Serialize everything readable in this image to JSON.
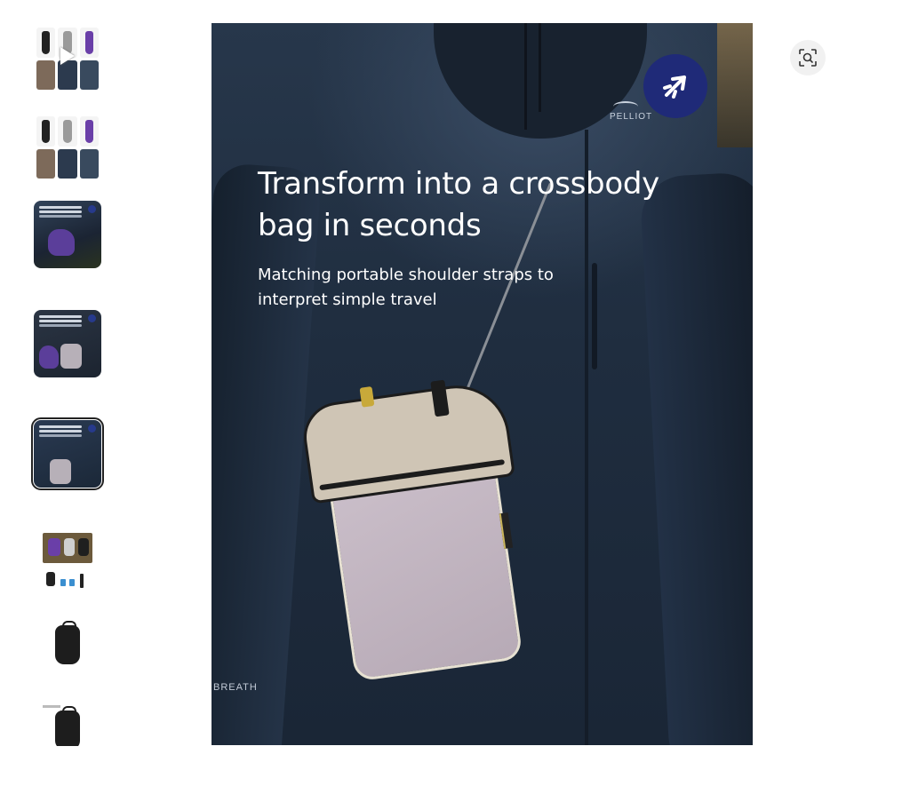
{
  "thumbnails": [
    {
      "label": "Video preview",
      "kind": "grid-video"
    },
    {
      "label": "Product variants",
      "kind": "grid"
    },
    {
      "label": "Purple bag photo",
      "kind": "photo-purple"
    },
    {
      "label": "Backpack photo",
      "kind": "photo-backpack"
    },
    {
      "label": "Crossbody photo",
      "kind": "photo-crossbody",
      "selected": true
    },
    {
      "label": "Colors and accessories",
      "kind": "colors"
    },
    {
      "label": "Black pack front",
      "kind": "black-pack"
    },
    {
      "label": "Black pack side",
      "kind": "black-pack"
    }
  ],
  "main_image": {
    "headline": "Transform into a crossbody bag in seconds",
    "subline": "Matching portable shoulder straps to interpret simple travel",
    "brand_text": "PELLIOT",
    "sleeve_text": "BREATH",
    "badge_icon": "plane-icon"
  },
  "zoom_button": {
    "icon": "zoom-scan-icon"
  },
  "colors": {
    "accent_badge": "#1f2a78",
    "jacket": "#1f2d3f",
    "bag_body": "#b7aab6",
    "purple_variant": "#5b3e9a"
  }
}
